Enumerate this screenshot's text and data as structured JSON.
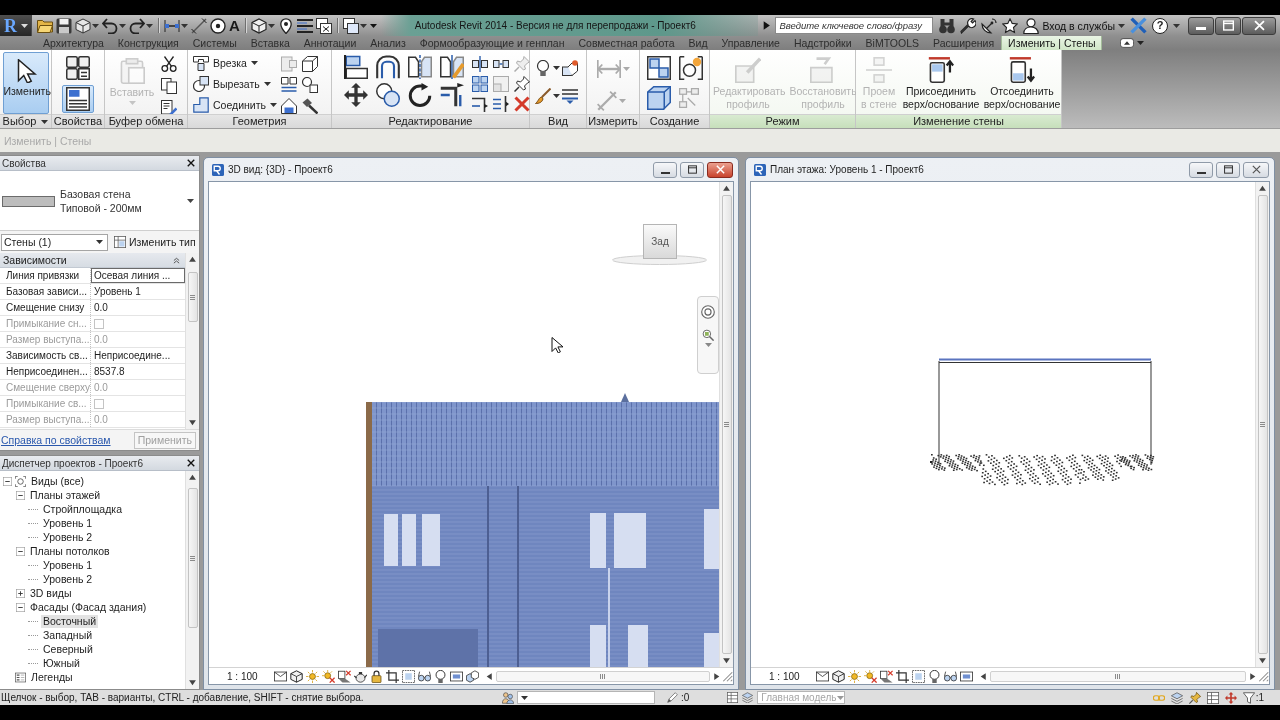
{
  "title_bar": {
    "app_button": "R",
    "text_tool": "A",
    "title": "Autodesk Revit 2014 - Версия не для перепродажи - Проект6",
    "search": {
      "placeholder": "Введите ключевое слово/фразу"
    },
    "sign_in": "Вход в службы",
    "help": "?"
  },
  "ribbon_tabs": [
    {
      "label": "Архитектура",
      "selected": false
    },
    {
      "label": "Конструкция",
      "selected": false
    },
    {
      "label": "Системы",
      "selected": false
    },
    {
      "label": "Вставка",
      "selected": false
    },
    {
      "label": "Аннотации",
      "selected": false
    },
    {
      "label": "Анализ",
      "selected": false
    },
    {
      "label": "Формообразующие и генплан",
      "selected": false
    },
    {
      "label": "Совместная работа",
      "selected": false
    },
    {
      "label": "Вид",
      "selected": false
    },
    {
      "label": "Управление",
      "selected": false
    },
    {
      "label": "Надстройки",
      "selected": false
    },
    {
      "label": "BiMTOOLS",
      "selected": false
    },
    {
      "label": "Расширения",
      "selected": false
    },
    {
      "label": "Изменить | Стены",
      "selected": true
    }
  ],
  "ribbon_panels": [
    {
      "kind": "select",
      "title": "Выбор",
      "menu": true,
      "contextual": false,
      "buttons": [
        {
          "label": "Изменить",
          "selected": true,
          "disabled": false
        }
      ]
    },
    {
      "kind": "properties",
      "title": "Свойства",
      "menu": false,
      "contextual": false,
      "buttons": [
        {
          "selected": false,
          "disabled": false
        },
        {
          "selected": true,
          "disabled": false
        }
      ]
    },
    {
      "kind": "clipboard",
      "title": "Буфер обмена",
      "menu": false,
      "contextual": false,
      "buttons": [
        {
          "label": "Вставить",
          "selected": false,
          "disabled": true
        }
      ]
    },
    {
      "kind": "geometry",
      "title": "Геометрия",
      "menu": false,
      "contextual": false,
      "buttons": [
        {
          "label": "Врезка",
          "selected": false,
          "disabled": false
        },
        {
          "label": "Вырезать",
          "selected": false,
          "disabled": false
        },
        {
          "label": "Соединить",
          "selected": false,
          "disabled": false
        }
      ]
    },
    {
      "kind": "modify",
      "title": "Редактирование",
      "menu": false,
      "contextual": false
    },
    {
      "kind": "view",
      "title": "Вид",
      "menu": false,
      "contextual": false
    },
    {
      "kind": "measure",
      "title": "Измерить",
      "menu": false,
      "contextual": false
    },
    {
      "kind": "create",
      "title": "Создание",
      "menu": false,
      "contextual": false
    },
    {
      "kind": "mode",
      "title": "Режим",
      "menu": false,
      "contextual": true,
      "buttons": [
        {
          "label": "Редактировать профиль",
          "selected": false,
          "disabled": true
        },
        {
          "label": "Восстановить профиль",
          "selected": false,
          "disabled": true
        }
      ]
    },
    {
      "kind": "wall",
      "title": "Изменение стены",
      "menu": false,
      "contextual": true,
      "buttons": [
        {
          "label": "Проем в стене",
          "selected": false,
          "disabled": true
        },
        {
          "label": "Присоединить верх/основание",
          "selected": false,
          "disabled": false
        },
        {
          "label": "Отсоединить верх/основание",
          "selected": false,
          "disabled": false
        }
      ]
    }
  ],
  "options_bar": {
    "context": "Изменить | Стены"
  },
  "properties": {
    "title": "Свойства",
    "type": {
      "family": "Базовая стена",
      "name": "Типовой - 200мм"
    },
    "filter": "Стены (1)",
    "edit_type": "Изменить тип",
    "groups": [
      {
        "name": "Зависимости",
        "expanded": true,
        "rows": [
          {
            "label": "Линия привязки",
            "value": "Осевая линия ...",
            "kind": "text",
            "disabled": false,
            "selected": true
          },
          {
            "label": "Базовая зависи...",
            "value": "Уровень 1",
            "kind": "text",
            "disabled": false,
            "selected": false
          },
          {
            "label": "Смещение снизу",
            "value": "0.0",
            "kind": "text",
            "disabled": false,
            "selected": false
          },
          {
            "label": "Примыкание сн...",
            "kind": "checkbox",
            "checked": false,
            "disabled": true,
            "selected": false
          },
          {
            "label": "Размер выступа...",
            "value": "0.0",
            "kind": "text",
            "disabled": true,
            "selected": false
          },
          {
            "label": "Зависимость св...",
            "value": "Неприсоедине...",
            "kind": "text",
            "disabled": false,
            "selected": false
          },
          {
            "label": "Неприсоединен...",
            "value": "8537.8",
            "kind": "text",
            "disabled": false,
            "selected": false
          },
          {
            "label": "Смещение сверху",
            "value": "0.0",
            "kind": "text",
            "disabled": true,
            "selected": false
          },
          {
            "label": "Примыкание св...",
            "kind": "checkbox",
            "checked": false,
            "disabled": true,
            "selected": false
          },
          {
            "label": "Размер выступа...",
            "value": "0.0",
            "kind": "text",
            "disabled": true,
            "selected": false
          }
        ]
      }
    ],
    "help_link": "Справка по свойствам",
    "apply": {
      "label": "Применить",
      "disabled": true
    }
  },
  "project_browser": {
    "title": "Диспетчер проектов - Проект6",
    "tree": [
      {
        "label": "Виды (все)",
        "kind": "views",
        "expanded": true,
        "selected": false,
        "children": [
          {
            "label": "Планы этажей",
            "expanded": true,
            "selected": false,
            "children": [
              {
                "label": "Стройплощадка",
                "selected": false
              },
              {
                "label": "Уровень 1",
                "selected": false
              },
              {
                "label": "Уровень 2",
                "selected": false
              }
            ]
          },
          {
            "label": "Планы потолков",
            "expanded": true,
            "selected": false,
            "children": [
              {
                "label": "Уровень 1",
                "selected": false
              },
              {
                "label": "Уровень 2",
                "selected": false
              }
            ]
          },
          {
            "label": "3D виды",
            "expanded": false,
            "selected": false
          },
          {
            "label": "Фасады (Фасад здания)",
            "expanded": true,
            "selected": false,
            "children": [
              {
                "label": "Восточный",
                "selected": true
              },
              {
                "label": "Западный",
                "selected": false
              },
              {
                "label": "Северный",
                "selected": false
              },
              {
                "label": "Южный",
                "selected": false
              }
            ]
          }
        ]
      },
      {
        "label": "Легенды",
        "kind": "legends",
        "selected": false
      }
    ]
  },
  "views": [
    {
      "kind": "perspective",
      "title": "3D вид: {3D} - Проект6",
      "active": true,
      "view_cube": "Зад",
      "scale": "1 : 100"
    },
    {
      "kind": "plan",
      "title": "План этажа: Уровень 1 - Проект6",
      "active": false,
      "scale": "1 : 100"
    }
  ],
  "status_bar": {
    "hint": "Щелчок - выбор, TAB - варианты, CTRL - добавление, SHIFT - снятие выбора.",
    "editable_count": ":0",
    "model": {
      "value": "Главная модель",
      "disabled": true
    },
    "selection_count": ":1"
  }
}
